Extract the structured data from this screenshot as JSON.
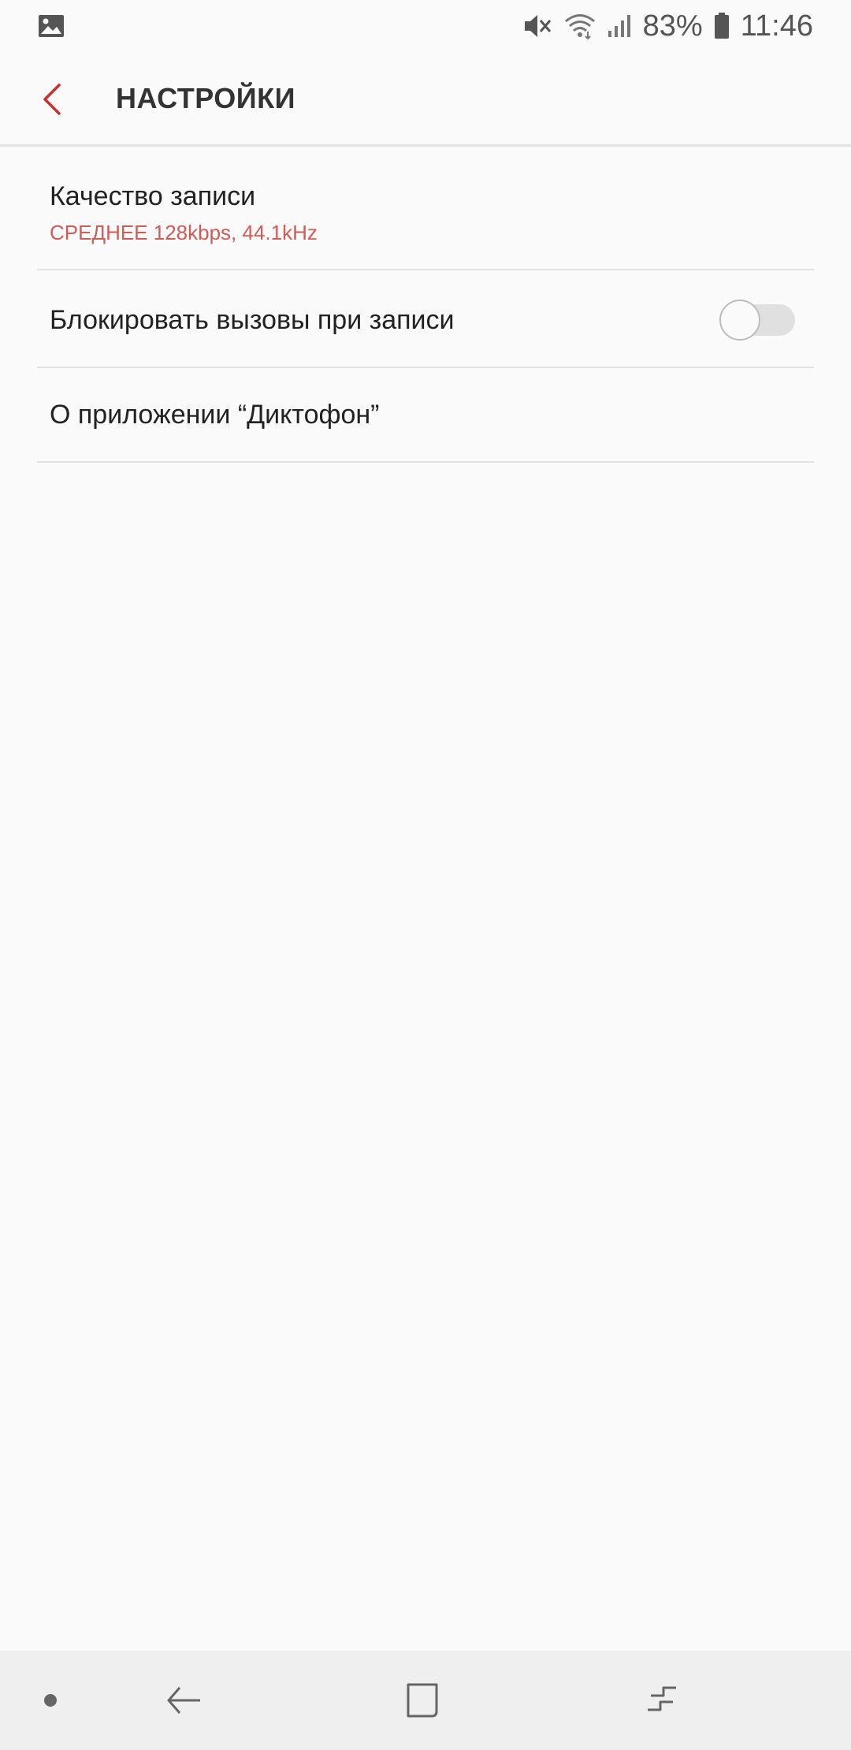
{
  "status_bar": {
    "battery_percent": "83%",
    "time": "11:46",
    "icons": [
      "image-notification-icon",
      "mute-icon",
      "wifi-icon",
      "signal-icon",
      "battery-icon"
    ]
  },
  "app_bar": {
    "title": "НАСТРОЙКИ",
    "back_icon": "chevron-left-icon"
  },
  "settings": {
    "recording_quality": {
      "title": "Качество записи",
      "subtitle": "СРЕДНЕЕ 128kbps, 44.1kHz"
    },
    "block_calls": {
      "title": "Блокировать вызовы при записи",
      "enabled": false
    },
    "about": {
      "title": "О приложении “Диктофон”"
    }
  },
  "nav_bar": {
    "items": [
      "dot-icon",
      "back-arrow-icon",
      "home-square-icon",
      "recents-icon"
    ]
  },
  "colors": {
    "accent": "#c9302c",
    "subtitle": "#d35a55",
    "background": "#fafafa",
    "navbar": "#efefef"
  }
}
